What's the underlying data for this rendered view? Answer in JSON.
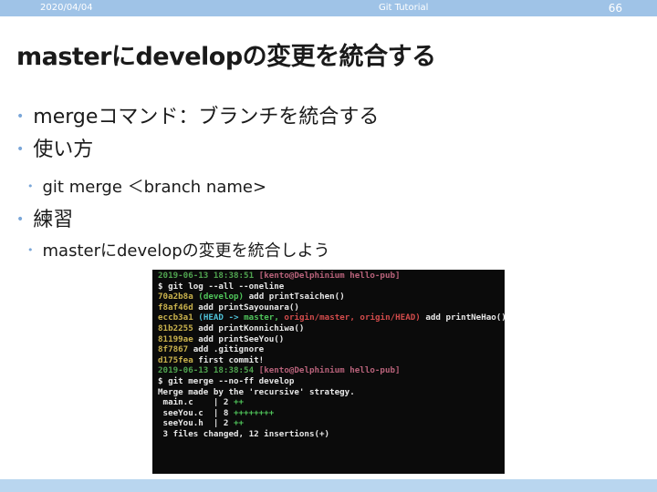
{
  "header": {
    "date": "2020/04/04",
    "title": "Git Tutorial",
    "page": "66"
  },
  "slide": {
    "title": "masterにdevelopの変更を統合する",
    "bullets": [
      "mergeコマンド：ブランチを統合する",
      "使い方",
      "git merge ＜branch name>",
      "練習",
      "masterにdevelopの変更を統合しよう"
    ]
  },
  "terminal": {
    "prompt1": {
      "date": "2019-06-13 18:38:51",
      "user": "[kento@Delphinium hello-pub]"
    },
    "cmd1": "$ git log --all --oneline",
    "log": [
      {
        "hash": "70a2b8a",
        "ref": "(develop)",
        "msg": "add printTsaichen()"
      },
      {
        "hash": "f8af46d",
        "msg": "add printSayounara()"
      },
      {
        "hash": "eccb3a1",
        "ref_head": "(HEAD",
        "ref_arrow": "->",
        "ref_master": "master,",
        "ref_origin_master": "origin/master,",
        "ref_origin_head": "origin/HEAD)",
        "msg": "add printNeHao()"
      },
      {
        "hash": "81b2255",
        "msg": "add printKonnichiwa()"
      },
      {
        "hash": "81199ae",
        "msg": "add printSeeYou()"
      },
      {
        "hash": "8f7867",
        "msg": "add .gitignore"
      },
      {
        "hash": "d175fea",
        "msg": "first commit!"
      }
    ],
    "prompt2": {
      "date": "2019-06-13 18:38:54",
      "user": "[kento@Delphinium hello-pub]"
    },
    "cmd2": "$ git merge --no-ff develop",
    "merge_msg": "Merge made by the 'recursive' strategy.",
    "files": [
      {
        "name": " main.c    | 2 ",
        "plus": "++"
      },
      {
        "name": " seeYou.c  | 8 ",
        "plus": "++++++++"
      },
      {
        "name": " seeYou.h  | 2 ",
        "plus": "++"
      }
    ],
    "summary": " 3 files changed, 12 insertions(+)"
  }
}
